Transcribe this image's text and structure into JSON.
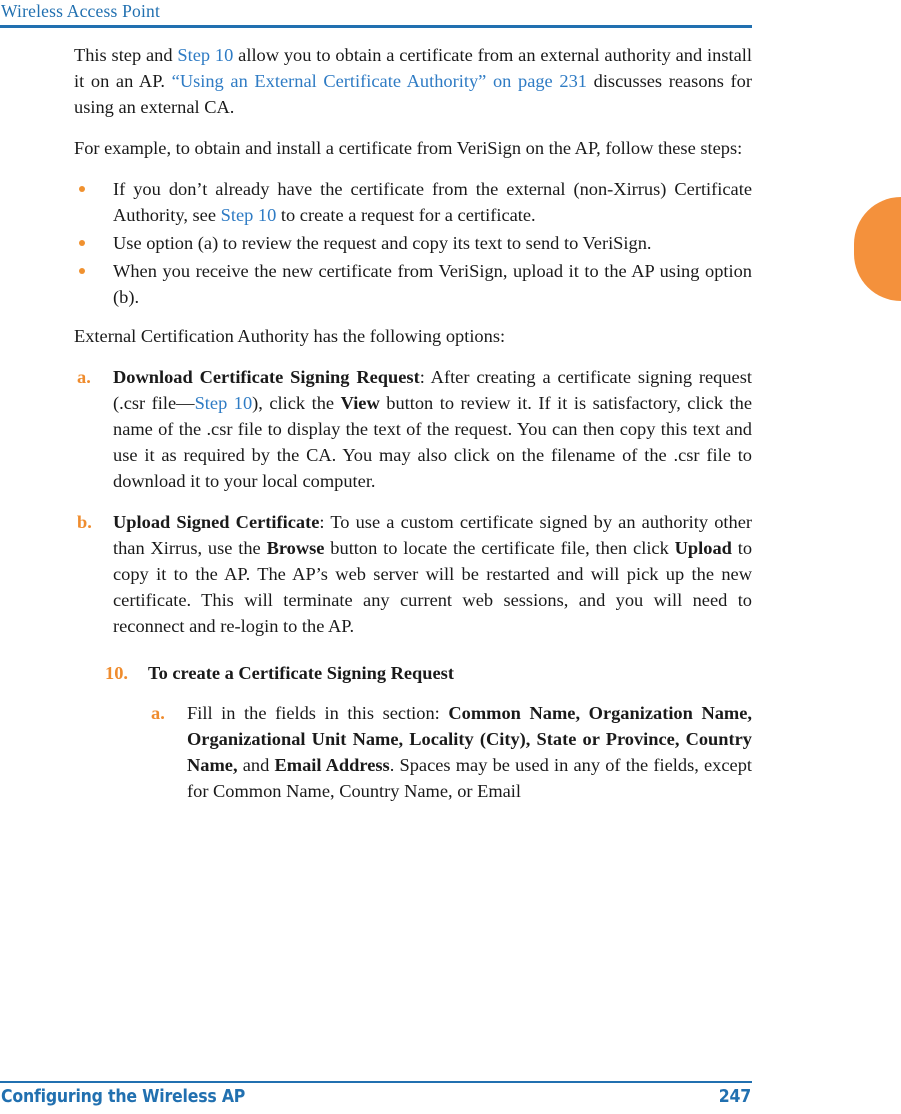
{
  "header": {
    "running_title": "Wireless Access Point",
    "rule_color": "#2170b0"
  },
  "edge_tab": {
    "color": "#f4913c",
    "label": ""
  },
  "colors": {
    "link_blue": "#2e7bc4",
    "header_blue": "#2170b0",
    "accent_orange": "#ef8c2e",
    "bullet_orange": "#f0912f",
    "body_text": "#1a1a1a"
  },
  "content": {
    "intro_para": {
      "seg1": "This step and ",
      "link1": "Step 10",
      "seg2": " allow you to obtain a certificate from an external authority and install it on an AP. ",
      "link2": "“Using an External Certificate Authority” on page 231",
      "seg3": " discusses reasons for using an external CA."
    },
    "example_para": "For example, to obtain and install a certificate from VeriSign on the AP, follow these steps:",
    "bullets": [
      {
        "seg1": "If you don’t already have the certificate from the external (non-Xirrus) Certificate Authority, see ",
        "link": "Step 10",
        "seg2": " to create a request for a certificate."
      },
      {
        "seg1": "Use option (a) to review the request and copy its text to send to VeriSign.",
        "link": "",
        "seg2": ""
      },
      {
        "seg1": "When you receive the new certificate from VeriSign, upload it to the AP using option (b).",
        "link": "",
        "seg2": ""
      }
    ],
    "options_lead": "External Certification Authority has the following options:",
    "options": [
      {
        "marker": "a.",
        "title": "Download Certificate Signing Request",
        "seg1": ": After creating a certificate signing request (.csr file—",
        "link": "Step 10",
        "seg2": "), click the ",
        "bold2": "View",
        "seg3": " button to review it. If it is satisfactory, click the name of the .csr file to display the text of the request. You can then copy this text and use it as required by the CA. You may also click on the filename of the .csr file to download it to your local computer."
      },
      {
        "marker": "b.",
        "title": "Upload Signed Certificate",
        "seg1": ": To use a custom certificate signed by an authority other than Xirrus, use the ",
        "link": "",
        "seg2": "",
        "bold2": "Browse",
        "seg3": " button to locate the certificate file, then click ",
        "bold3": "Upload",
        "seg4": " to copy it to the AP. The AP’s web server will be restarted and will pick up the new certificate. This will terminate any current web sessions, and you will need to reconnect and re-login to the AP."
      }
    ],
    "step_block": {
      "number": "10.",
      "title": "To create a Certificate Signing Request",
      "sub_items": [
        {
          "marker": "a.",
          "seg1": "Fill in the fields in this section: ",
          "bold1": "Common Name, Organization Name, Organizational Unit Name, Locality (City), State or Province, Country Name,",
          "seg2": " and ",
          "bold2": "Email Address",
          "seg3": ". Spaces may be used in any of the fields, except for Common Name, Country Name, or Email"
        }
      ]
    }
  },
  "footer": {
    "left_text": "Configuring the Wireless AP",
    "page_number": "247",
    "rule_color": "#2170b0"
  }
}
